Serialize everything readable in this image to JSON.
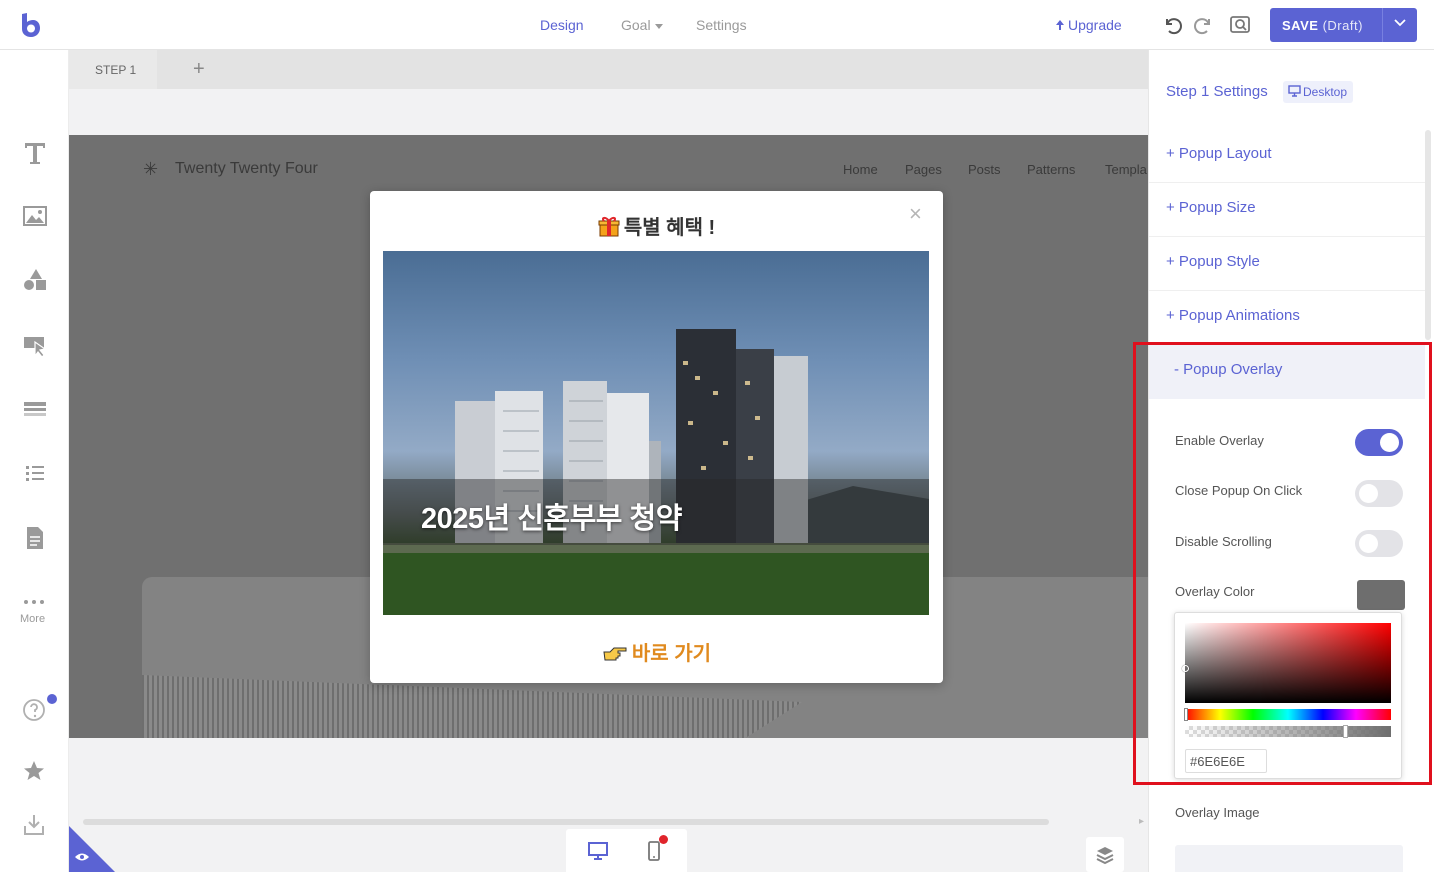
{
  "topbar": {
    "tabs": [
      {
        "label": "Design",
        "active": true
      },
      {
        "label": "Goal"
      },
      {
        "label": "Settings"
      }
    ],
    "upgrade_label": "Upgrade",
    "save_label": "SAVE",
    "save_status": "(Draft)"
  },
  "leftbar": {
    "tools": [
      "text-icon",
      "image-icon",
      "shapes-icon",
      "button-icon",
      "form-icon",
      "list-icon",
      "document-icon",
      "more-icon"
    ],
    "more_label": "More"
  },
  "canvas": {
    "step_tab": "STEP 1",
    "add_step": "+",
    "site": {
      "star": "✳",
      "title": "Twenty Twenty Four",
      "nav": [
        "Home",
        "Pages",
        "Posts",
        "Patterns",
        "Templa"
      ]
    }
  },
  "popup": {
    "close": "×",
    "title": "특별 혜택 !",
    "image_caption": "2025년 신혼부부 청약",
    "cta": "바로 가기"
  },
  "panel": {
    "title": "Step 1 Settings",
    "device": "Desktop",
    "sections": [
      "+ Popup Layout",
      "+ Popup Size",
      "+ Popup Style",
      "+ Popup Animations"
    ],
    "open_section": "-  Popup Overlay",
    "options": {
      "enable_overlay": {
        "label": "Enable Overlay",
        "on": true
      },
      "close_on_click": {
        "label": "Close Popup On Click",
        "on": false
      },
      "disable_scrolling": {
        "label": "Disable Scrolling",
        "on": false
      },
      "overlay_color": {
        "label": "Overlay Color",
        "value": "#6E6E6E"
      },
      "overlay_image": {
        "label": "Overlay Image"
      }
    }
  },
  "colors": {
    "accent": "#5b63d3",
    "overlay": "#6e6e6e",
    "cta": "#e08a1e",
    "highlight": "#e0101d"
  }
}
